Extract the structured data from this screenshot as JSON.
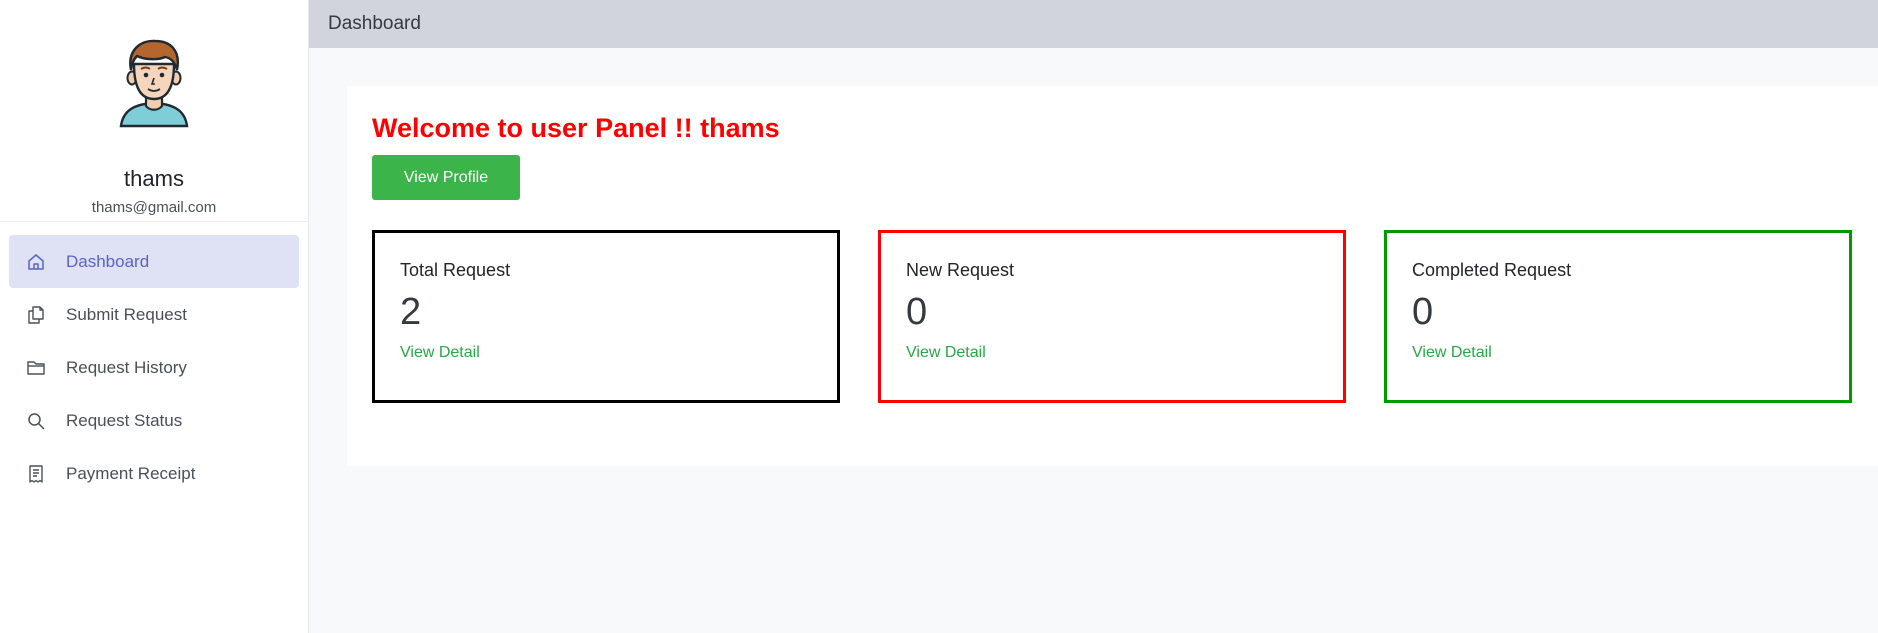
{
  "header": {
    "title": "Dashboard"
  },
  "sidebar": {
    "profile": {
      "name": "thams",
      "email": "thams@gmail.com",
      "avatar_icon": "user-avatar-icon"
    },
    "items": [
      {
        "label": "Dashboard",
        "icon": "home-icon",
        "active": true
      },
      {
        "label": "Submit Request",
        "icon": "documents-icon",
        "active": false
      },
      {
        "label": "Request History",
        "icon": "folder-icon",
        "active": false
      },
      {
        "label": "Request Status",
        "icon": "search-icon",
        "active": false
      },
      {
        "label": "Payment Receipt",
        "icon": "receipt-icon",
        "active": false
      }
    ]
  },
  "main": {
    "welcome_text": "Welcome to user Panel !! thams",
    "view_profile_label": "View Profile",
    "stats": [
      {
        "title": "Total Request",
        "value": "2",
        "link": "View Detail",
        "border_color": "#000000"
      },
      {
        "title": "New Request",
        "value": "0",
        "link": "View Detail",
        "border_color": "#ff0000"
      },
      {
        "title": "Completed Request",
        "value": "0",
        "link": "View Detail",
        "border_color": "#009900"
      }
    ]
  },
  "colors": {
    "accent_active": "#5b63c7",
    "active_bg": "#dfe1f5",
    "welcome": "#ff0000",
    "button": "#3bb54a",
    "link": "#28a745",
    "header_bg": "#d1d5db"
  }
}
